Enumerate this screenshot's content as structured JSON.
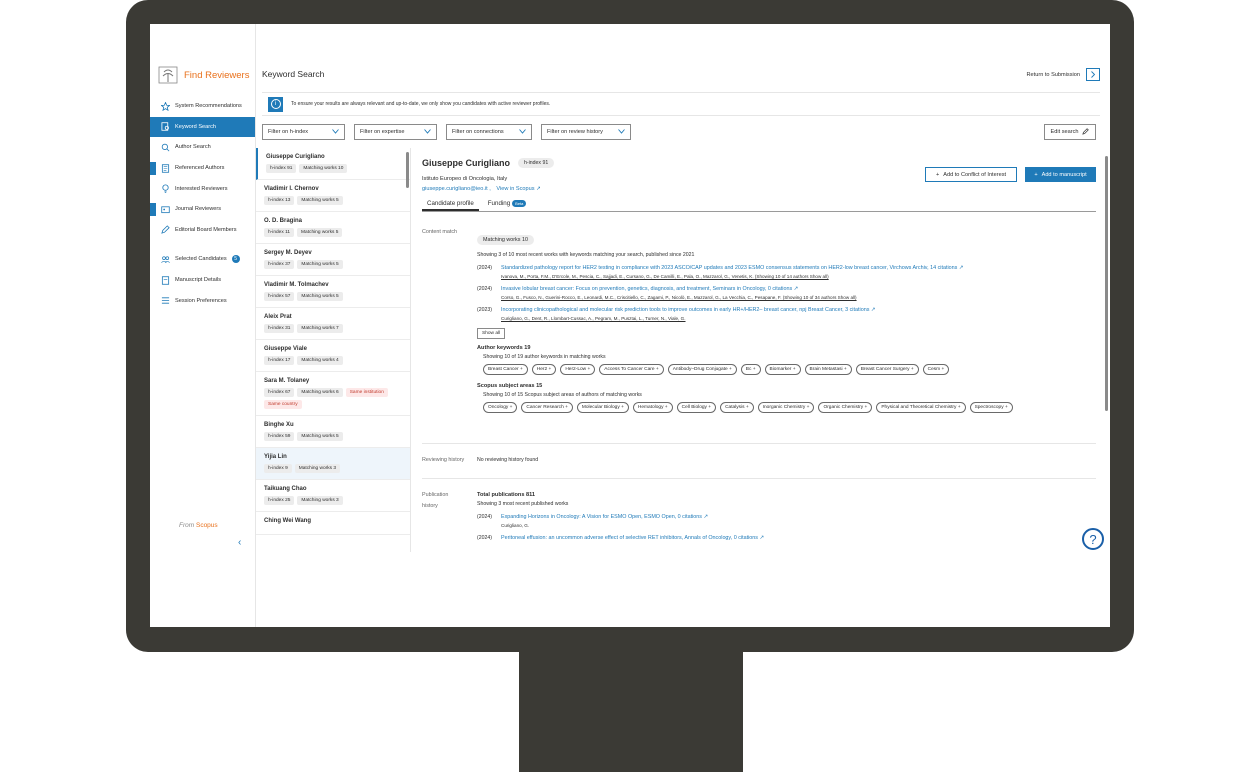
{
  "app": {
    "name": "Find Reviewers",
    "page_title": "Keyword Search",
    "return_label": "Return to Submission"
  },
  "sidebar": {
    "items": [
      {
        "label": "System Recommendations",
        "icon": "star-icon"
      },
      {
        "label": "Keyword Search",
        "icon": "search-doc-icon"
      },
      {
        "label": "Author Search",
        "icon": "search-icon"
      },
      {
        "label": "Referenced Authors",
        "icon": "doc-icon"
      },
      {
        "label": "Interested Reviewers",
        "icon": "bulb-icon"
      },
      {
        "label": "Journal Reviewers",
        "icon": "journal-icon"
      },
      {
        "label": "Editorial Board Members",
        "icon": "pen-icon"
      },
      {
        "label": "Selected Candidates",
        "icon": "users-icon",
        "count": "5"
      },
      {
        "label": "Manuscript Details",
        "icon": "manuscript-icon"
      },
      {
        "label": "Session Preferences",
        "icon": "list-icon"
      }
    ],
    "footer_from": "From",
    "footer_scopus": "Scopus"
  },
  "info": {
    "text": "To ensure your results are always relevant and up-to-date, we only show you candidates with active reviewer profiles."
  },
  "filters": [
    "Filter on h-index",
    "Filter on expertise",
    "Filter on connections",
    "Filter on review history"
  ],
  "edit_search": "Edit search",
  "candidates": [
    {
      "name": "Giuseppe Curigliano",
      "tags": [
        "h-index 91",
        "Matching works 10"
      ]
    },
    {
      "name": "Vladimir I. Chernov",
      "tags": [
        "h-index 13",
        "Matching works 5"
      ]
    },
    {
      "name": "O. D. Bragina",
      "tags": [
        "h-index 11",
        "Matching works 5"
      ]
    },
    {
      "name": "Sergey M. Deyev",
      "tags": [
        "h-index 37",
        "Matching works 5"
      ]
    },
    {
      "name": "Vladimir M. Tolmachev",
      "tags": [
        "h-index 57",
        "Matching works 5"
      ]
    },
    {
      "name": "Aleix Prat",
      "tags": [
        "h-index 31",
        "Matching works 7"
      ]
    },
    {
      "name": "Giuseppe Viale",
      "tags": [
        "h-index 17",
        "Matching works 4"
      ]
    },
    {
      "name": "Sara M. Tolaney",
      "tags": [
        "h-index 67",
        "Matching works 6"
      ],
      "warn": [
        "Same institution",
        "Same country"
      ]
    },
    {
      "name": "Binghe Xu",
      "tags": [
        "h-index 59",
        "Matching works 5"
      ]
    },
    {
      "name": "Yijia Lin",
      "tags": [
        "h-index 9",
        "Matching works 3"
      ]
    },
    {
      "name": "Taikuang Chao",
      "tags": [
        "h-index 25",
        "Matching works 3"
      ]
    },
    {
      "name": "Ching Wei Wang",
      "tags": []
    }
  ],
  "detail": {
    "name": "Giuseppe Curigliano",
    "hindex": "h-index 91",
    "institution": "Istituto Europeo di Oncologia, Italy",
    "email": "giuseppe.curigliano@ieo.it ,",
    "scopus_link": "View in Scopus ↗",
    "btn_conflict": "Add to Conflict of Interest",
    "btn_add": "Add to manuscript",
    "tab_profile": "Candidate profile",
    "tab_funding": "Funding",
    "tab_beta": "Beta",
    "content_match_label": "Content match",
    "matching_pill": "Matching works 10",
    "matching_desc": "Showing 3 of 10 most recent works with keywords matching your search, published since 2021",
    "works": [
      {
        "year": "(2024)",
        "title": "Standardized pathology report for HER2 testing in compliance with 2023 ASCO/CAP updates and 2023 ESMO consensus statements on HER2-low breast cancer, Virchows Archiv, 14 citations ↗",
        "authors": "Ivanova, M., Porta, F.M., D'Ercole, M., Pescia, C., Sajjadi, E., Cursano, G., De Camilli, E., Pala, O., Mazzarol, G., Venetis, K. (Showing 10 of 14 authors Show all)"
      },
      {
        "year": "(2024)",
        "title": "Invasive lobular breast cancer: Focus on prevention, genetics, diagnosis, and treatment, Seminars in Oncology, 0 citations ↗",
        "authors": "Corso, G., Fusco, N., Guerini-Rocco, E., Leonardi, M.C., Criscitiello, C., Zagami, P., Nicolò, E., Mazzarol, G., La Vecchia, C., Pesapane, F. (Showing 10 of 34 authors Show all)"
      },
      {
        "year": "(2023)",
        "title": "Incorporating clinicopathological and molecular risk prediction tools to improve outcomes in early HR+/HER2– breast cancer, npj Breast Cancer, 3 citations ↗",
        "authors": "Curigliano, G., Dent, R., Llombart-Cussac, A., Pegram, M., Pusztai, L., Turner, N., Viale, G."
      }
    ],
    "show_all": "Show all",
    "author_kw_head": "Author keywords 19",
    "author_kw_desc": "Showing 10 of 19 author keywords in matching works",
    "author_kw": [
      "Breast Cancer +",
      "Her2 +",
      "Her2-Low +",
      "Access To Cancer Care +",
      "Antibody–Drug Conjugate +",
      "Bc +",
      "Biomarker +",
      "Brain Metastasi +",
      "Breast Cancer Surgery +",
      "Cesm +"
    ],
    "subject_head": "Scopus subject areas 15",
    "subject_desc": "Showing 10 of 15 Scopus subject areas of authors of matching works",
    "subjects": [
      "Oncology +",
      "Cancer Research +",
      "Molecular Biology +",
      "Hematology +",
      "Cell Biology +",
      "Catalysis +",
      "Inorganic Chemistry +",
      "Organic Chemistry +",
      "Physical and Theoretical Chemistry +",
      "Spectroscopy +"
    ],
    "reviewing_label": "Reviewing history",
    "reviewing_text": "No reviewing history found",
    "pub_label_1": "Publication",
    "pub_label_2": "history",
    "pub_total": "Total publications 811",
    "pub_desc": "Showing 3 most recent published works",
    "pubs": [
      {
        "year": "(2024)",
        "title": "Expanding Horizons in Oncology: A Vision for ESMO Open, ESMO Open, 0 citations ↗",
        "authors": "Curigliano, G."
      },
      {
        "year": "(2024)",
        "title": "Peritoneal effusion: an uncommon adverse effect of selective RET inhibitors, Annals of Oncology, 0 citations ↗",
        "authors": ""
      }
    ]
  },
  "help": "?"
}
